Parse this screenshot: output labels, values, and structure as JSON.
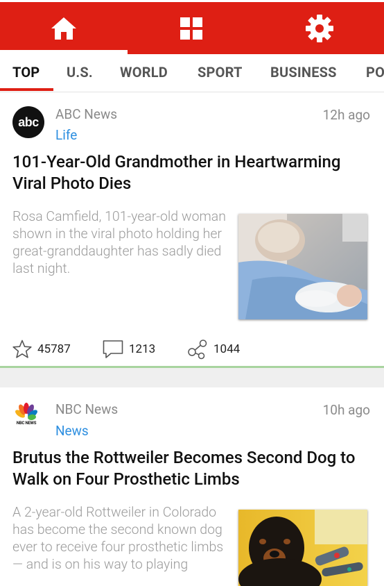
{
  "nav": {
    "tabs": [
      {
        "icon": "home-icon",
        "active": true
      },
      {
        "icon": "grid-icon",
        "active": false
      },
      {
        "icon": "gear-icon",
        "active": false
      }
    ]
  },
  "categories": [
    "TOP",
    "U.S.",
    "WORLD",
    "SPORT",
    "BUSINESS",
    "PO"
  ],
  "active_category": "TOP",
  "articles": [
    {
      "source": "ABC News",
      "logo_text": "abc",
      "category": "Life",
      "time": "12h ago",
      "headline": "101-Year-Old Grandmother in Heartwarming Viral Photo Dies",
      "summary": "Rosa Camfield, 101-year-old woman shown in the viral photo holding her great-granddaughter has sadly died last night.",
      "likes": "45787",
      "comments": "1213",
      "shares": "1044"
    },
    {
      "source": "NBC News",
      "logo_text": "NBC NEWS",
      "category": "News",
      "time": "10h ago",
      "headline": "Brutus the Rottweiler Becomes Second Dog to Walk on Four Prosthetic Limbs",
      "summary": "A 2-year-old Rottweiler in Colorado has become the second known dog ever to receive four prosthetic limbs — and is on his way to playing"
    }
  ],
  "colors": {
    "accent": "#de1f14",
    "category_link": "#2e8fe0",
    "card_divider": "#a8d49f"
  }
}
